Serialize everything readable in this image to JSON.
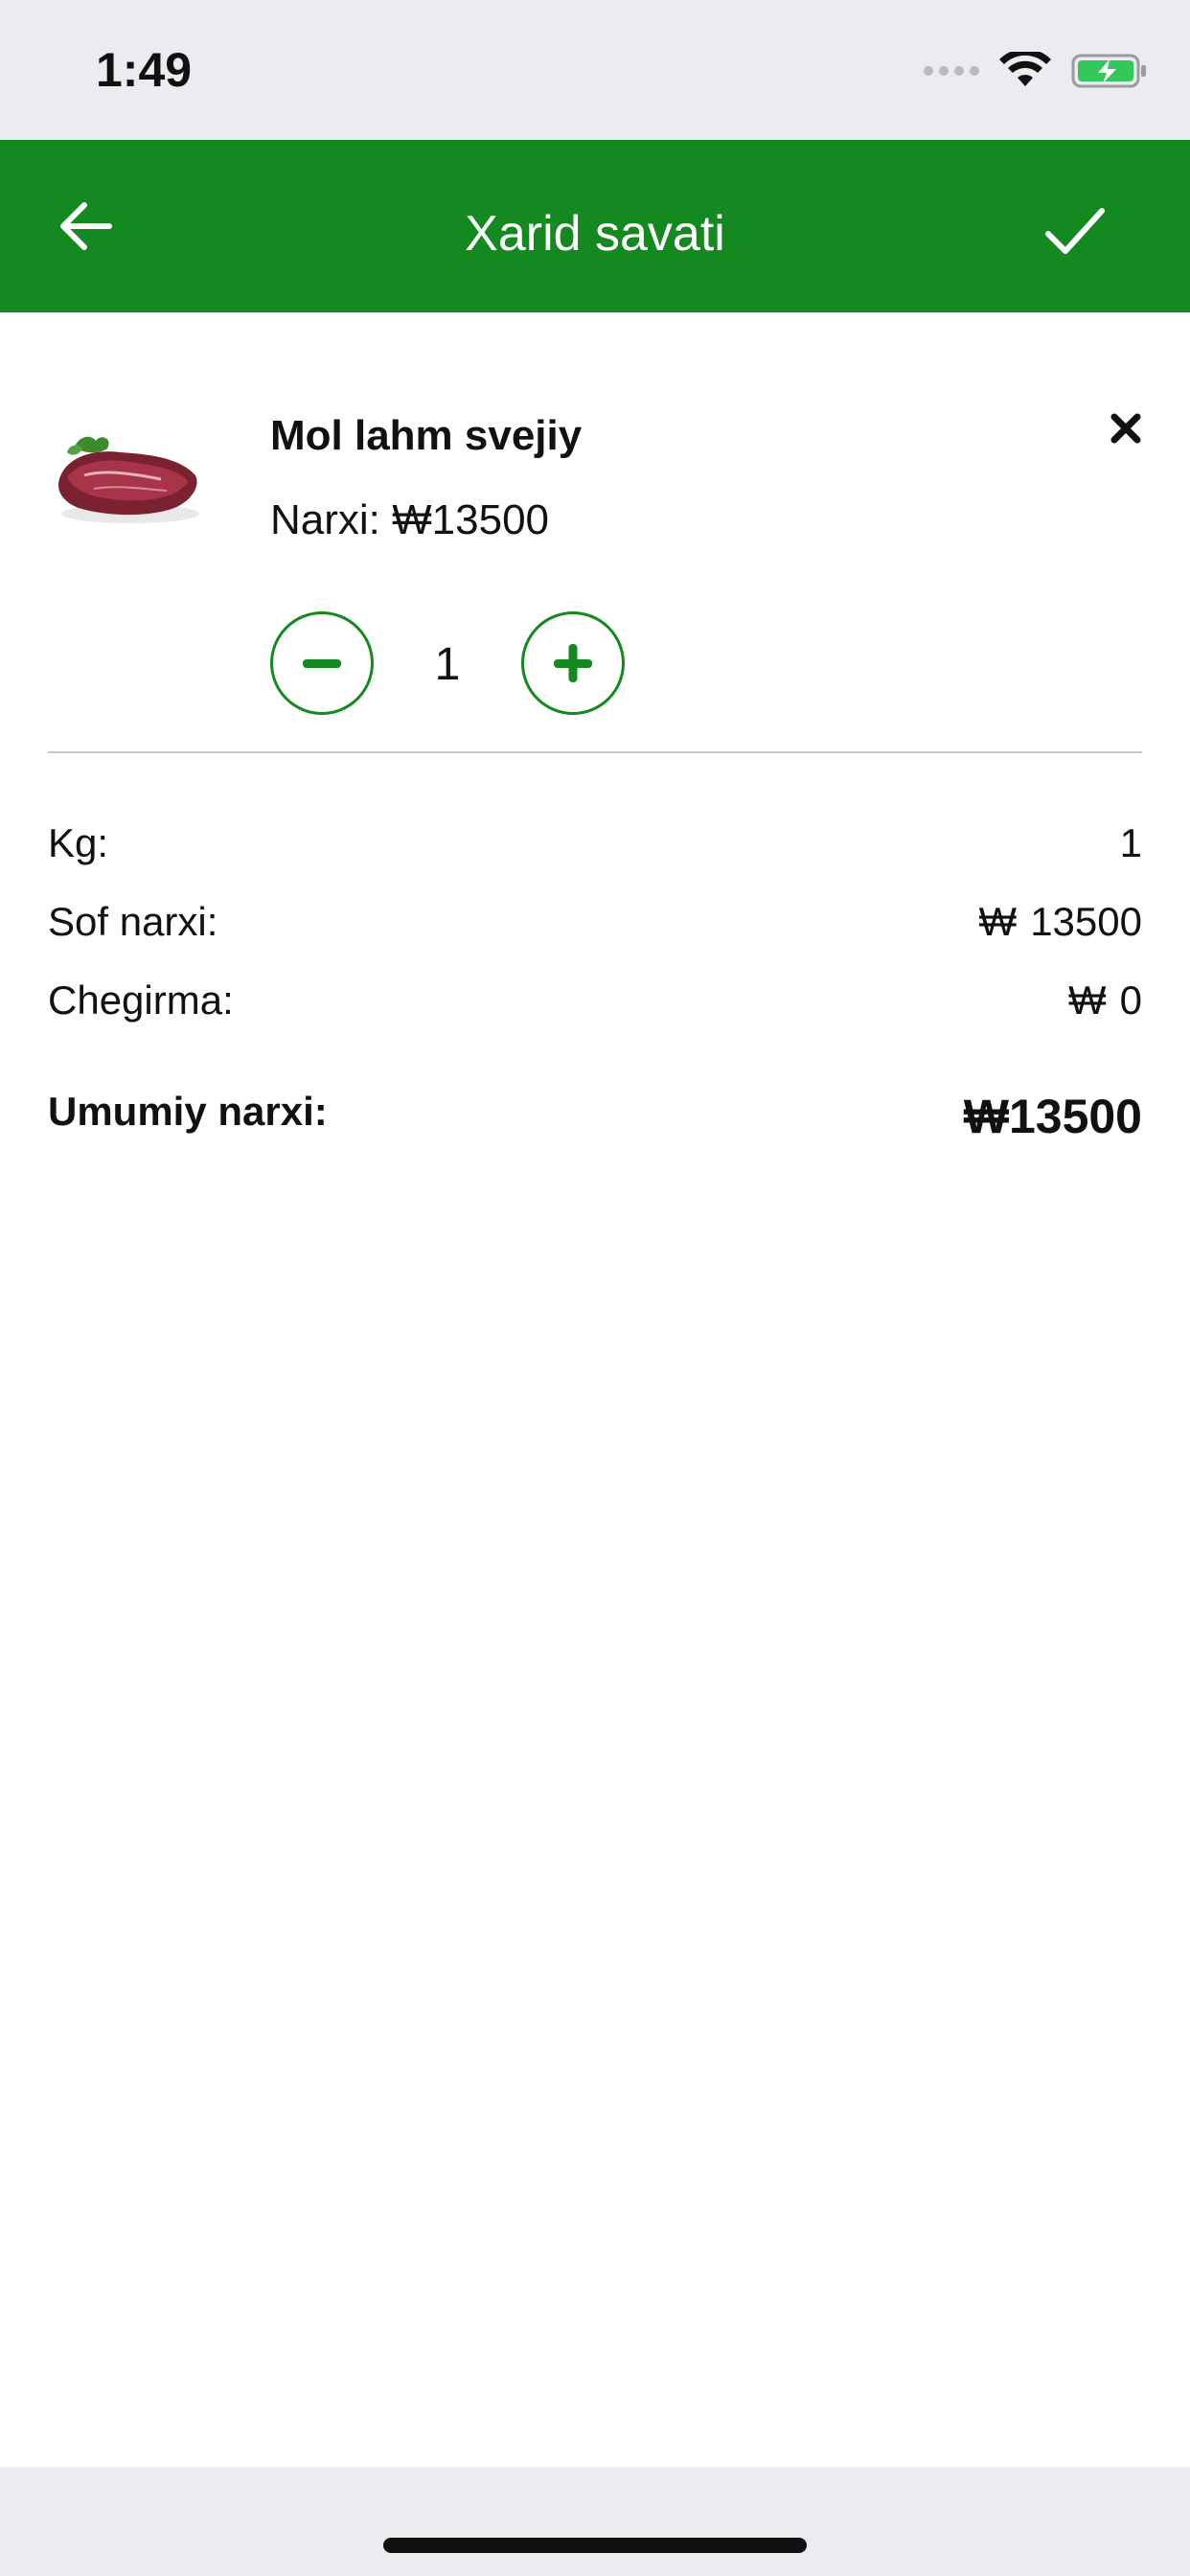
{
  "status_bar": {
    "time": "1:49"
  },
  "nav": {
    "title": "Xarid savati",
    "back_icon": "arrow-left-icon",
    "confirm_icon": "checkmark-icon"
  },
  "cart": {
    "item": {
      "name": "Mol lahm svejiy",
      "price_label": "Narxi:",
      "currency": "₩",
      "price": "13500",
      "quantity": "1",
      "image_icon": "meat-image"
    }
  },
  "summary": {
    "kg_label": "Kg:",
    "kg_value": "1",
    "net_label": "Sof narxi:",
    "net_value": "13500",
    "discount_label": "Chegirma:",
    "discount_value": "0",
    "total_label": "Umumiy narxi:",
    "total_value": "13500",
    "currency": "₩"
  },
  "colors": {
    "accent": "#13891f",
    "status_bg": "#ebebf0",
    "battery": "#34c759"
  }
}
